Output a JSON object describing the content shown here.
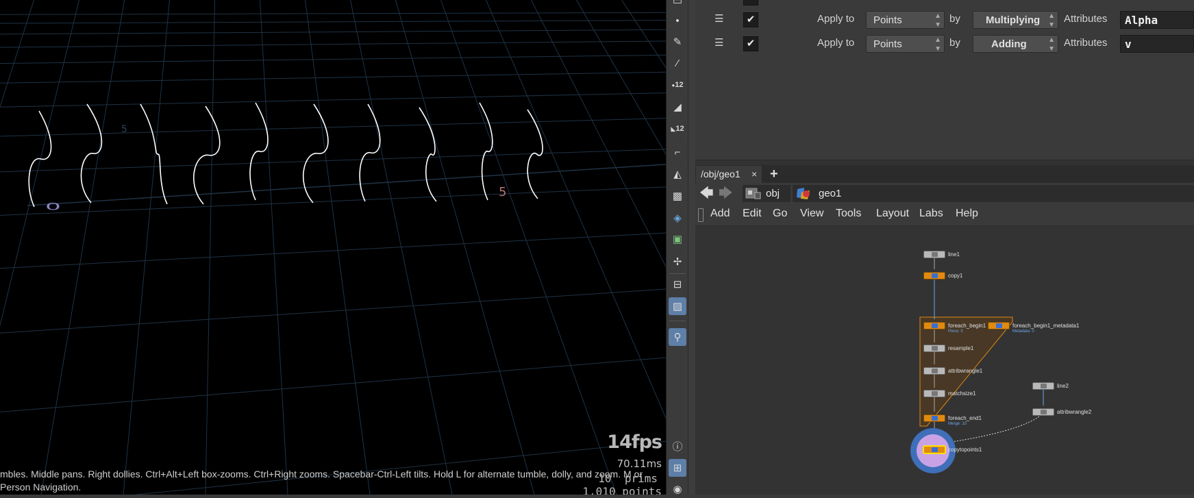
{
  "viewport": {
    "fps": "14fps",
    "frame_time": "70.11ms",
    "prims": "10  prims",
    "points": "1,010 points",
    "hint_line1": "mbles. Middle pans. Right dollies. Ctrl+Alt+Left box-zooms. Ctrl+Right zooms. Spacebar-Ctrl-Left tilts. Hold L for alternate tumble, dolly, and zoom. M or",
    "hint_line2": "Person Navigation.",
    "grid_numbers": [
      "0",
      "0",
      "5",
      "5"
    ]
  },
  "toolbar": {
    "icons": [
      "point-icon",
      "brush-icon",
      "paint-icon",
      "numbered-points-icon",
      "sculpt-icon",
      "numbered-brush-icon",
      "curve-icon",
      "pen-icon",
      "checker-icon",
      "transform-icon",
      "uv-icon",
      "move-icon",
      "stop-icon",
      "image-icon",
      "pin-location-icon",
      "info-icon",
      "layout-icon",
      "eye-icon"
    ],
    "badges": {
      "numbered_points": "12",
      "numbered_brush": "12"
    }
  },
  "params": {
    "rows": [
      {
        "apply_label": "Apply to",
        "target": "Points",
        "by_label": "by",
        "operation": "Multiplying",
        "attributes_label": "Attributes",
        "attribute_value": "Alpha",
        "enabled": true
      },
      {
        "apply_label": "Apply to",
        "target": "Points",
        "by_label": "by",
        "operation": "Adding",
        "attributes_label": "Attributes",
        "attribute_value": "v",
        "enabled": true
      }
    ],
    "check_mark": "✔",
    "drag_glyph": "☰"
  },
  "network": {
    "tab_label": "/obj/geo1",
    "tab_close": "×",
    "tab_add": "+",
    "path_obj": "obj",
    "path_geo": "geo1",
    "menus": [
      "Add",
      "Edit",
      "Go",
      "View",
      "Tools",
      "Layout",
      "Labs",
      "Help"
    ],
    "nodes": [
      {
        "name": "line1"
      },
      {
        "name": "copy1"
      },
      {
        "name": "foreach_begin1",
        "sub": "Piece: 0"
      },
      {
        "name": "foreach_begin1_metadata1",
        "sub": "Metadata: 0"
      },
      {
        "name": "resample1"
      },
      {
        "name": "attribwrangle1"
      },
      {
        "name": "matchsize1"
      },
      {
        "name": "foreach_end1",
        "sub": "Merge: 10"
      },
      {
        "name": "line2"
      },
      {
        "name": "attribwrangle2"
      },
      {
        "name": "copytopoints1"
      }
    ]
  },
  "colors": {
    "viewport_bg": "#000000",
    "curve": "#ffffff",
    "grid": "#1f3345",
    "node_orange": "#e08a12",
    "node_gray": "#b9b9b9",
    "block_fill": "#5a3d1a",
    "display_ring": "#3f6fb8",
    "selection": "#c9a2e6"
  }
}
